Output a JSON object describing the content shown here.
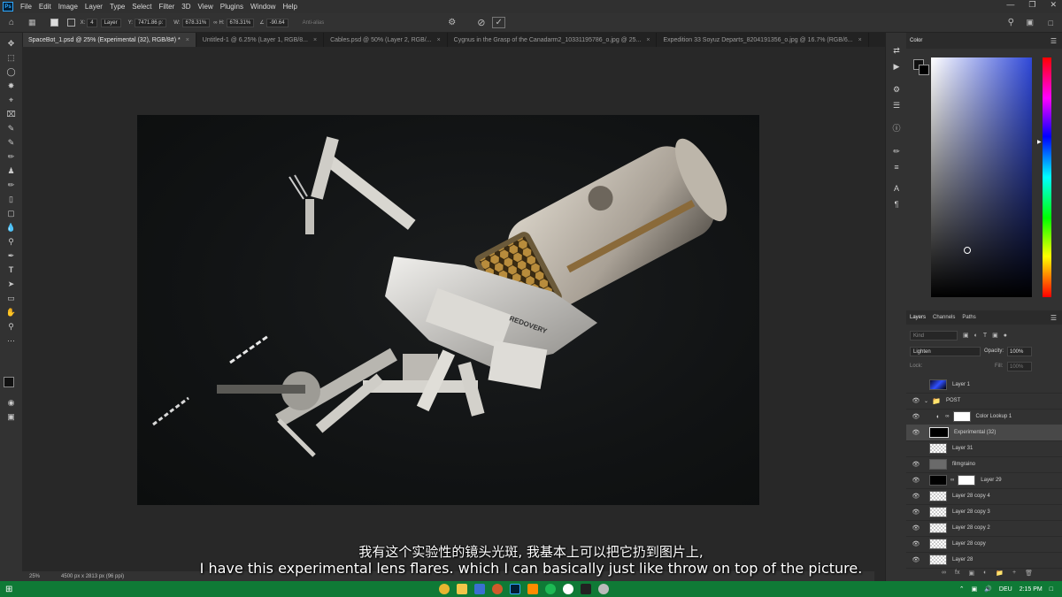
{
  "app": {
    "logo_text": "Ps"
  },
  "menu": [
    "File",
    "Edit",
    "Image",
    "Layer",
    "Type",
    "Select",
    "Filter",
    "3D",
    "View",
    "Plugins",
    "Window",
    "Help"
  ],
  "options_bar": {
    "reference_value": "4",
    "layer_dropdown": "Layer",
    "x_label": "X:",
    "y_label": "Y:",
    "y_value": "7471.86 p:",
    "w_label": "W:",
    "w_value": "678.31%",
    "h_label": "H:",
    "h_value": "678.31%",
    "angle_value": "-90.64",
    "antialias_label": "Anti-alias"
  },
  "tabs": [
    {
      "label": "SpaceBot_1.psd @ 25% (Experimental (32), RGB/8#) *",
      "active": true
    },
    {
      "label": "Untitled-1 @ 6.25% (Layer 1, RGB/8...",
      "active": false
    },
    {
      "label": "Cables.psd @ 50% (Layer 2, RGB/...",
      "active": false
    },
    {
      "label": "Cygnus in the Grasp of the Canadarm2_10331195786_o.jpg @ 25...",
      "active": false
    },
    {
      "label": "Expedition 33 Soyuz Departs_8204191356_o.jpg @ 16.7% (RGB/6...",
      "active": false
    }
  ],
  "status": {
    "zoom": "25%",
    "doc_size": "4500 px x 2813 px (96 ppi)"
  },
  "color_panel": {
    "tab": "Color",
    "colors": {
      "hue_top": "#3a5cff",
      "field_base": "#2f48d8"
    }
  },
  "layers_panel": {
    "tabs": [
      "Layers",
      "Channels",
      "Paths"
    ],
    "kind_label": "Kind",
    "blend_mode": "Lighten",
    "opacity_label": "Opacity:",
    "opacity_value": "100%",
    "lock_label": "Lock:",
    "fill_label": "Fill:",
    "fill_value": "100%",
    "layers": [
      {
        "name": "Layer 1",
        "visible": false,
        "thumb": "space"
      },
      {
        "name": "POST",
        "visible": true,
        "thumb": "folder"
      },
      {
        "name": "Color Lookup 1",
        "visible": true,
        "thumb": "adjust"
      },
      {
        "name": "Experimental (32)",
        "visible": true,
        "thumb": "black",
        "selected": true
      },
      {
        "name": "Layer 31",
        "visible": false,
        "thumb": "checker"
      },
      {
        "name": "filmgraino",
        "visible": true,
        "thumb": "grey"
      },
      {
        "name": "Layer 29",
        "visible": true,
        "thumb": "black"
      },
      {
        "name": "Layer 28 copy 4",
        "visible": true,
        "thumb": "checker"
      },
      {
        "name": "Layer 28 copy 3",
        "visible": true,
        "thumb": "checker"
      },
      {
        "name": "Layer 28 copy 2",
        "visible": true,
        "thumb": "checker"
      },
      {
        "name": "Layer 28 copy",
        "visible": true,
        "thumb": "checker"
      },
      {
        "name": "Layer 28",
        "visible": true,
        "thumb": "checker"
      }
    ]
  },
  "canvas": {
    "robot_badge": "REDOVERY"
  },
  "subtitles": {
    "chinese": "我有这个实验性的镜头光斑, 我基本上可以把它扔到图片上,",
    "english": "I have this experimental lens flares. which I can basically just like throw on top of the picture."
  },
  "taskbar": {
    "lang": "DEU",
    "time": "2:15 PM"
  }
}
